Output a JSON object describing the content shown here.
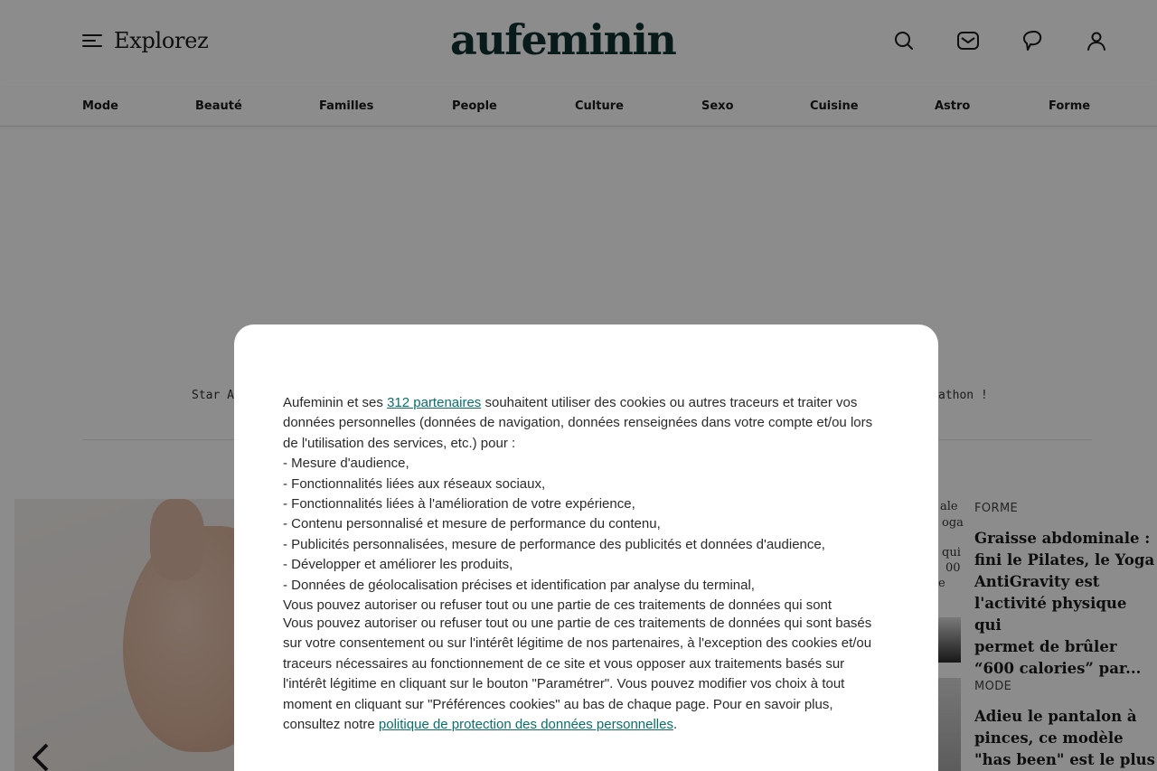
{
  "header": {
    "explore_label": "Explorez",
    "logo": "aufeminin",
    "icons": [
      "search-icon",
      "mail-icon",
      "chat-icon",
      "user-icon"
    ]
  },
  "nav": {
    "items": [
      "Mode",
      "Beauté",
      "Familles",
      "People",
      "Culture",
      "Sexo",
      "Cuisine",
      "Astro",
      "Forme"
    ]
  },
  "teaser": {
    "left_fragment": "Star Ac",
    "right_fragment": "athon !"
  },
  "side_fragments": [
    "ale",
    "oga",
    "qui",
    "00",
    "e"
  ],
  "articles": [
    {
      "category": "FORME",
      "title": "Graisse abdominale :\nfini le Pilates, le Yoga\nAntiGravity est\nl'activité physique qui\npermet de brûler\n“600 calories” par..."
    },
    {
      "category": "MODE",
      "title": "Adieu le pantalon à\npinces, ce modèle\n\"has been\" est le plus"
    }
  ],
  "consent": {
    "intro_before_link": "Aufeminin et ses ",
    "partners_link": "312 partenaires",
    "intro_after_link": " souhaitent utiliser des cookies ou autres traceurs et traiter vos données personnelles (données de navigation, données renseignées dans votre compte et/ou lors de l'utilisation des services, etc.) pour :",
    "purposes": [
      "- Mesure d'audience,",
      "- Fonctionnalités liées aux réseaux sociaux,",
      "- Fonctionnalités liées à l'amélioration de votre expérience,",
      "- Contenu personnalisé et mesure de performance du contenu,",
      "- Publicités personnalisées, mesure de performance des publicités et données d'audience,",
      "- Développer et améliorer les produits,",
      "- Données de géolocalisation précises et identification par analyse du terminal,"
    ],
    "overlap_line": "Vous pouvez autoriser ou refuser tout ou une partie de ces traitements de données qui sont",
    "body_text": "Vous pouvez autoriser ou refuser tout ou une partie de ces traitements de données qui sont basés sur votre consentement ou sur l'intérêt légitime de nos partenaires, à l'exception des cookies et/ou traceurs nécessaires au fonctionnement de ce site et vous opposer aux traitements basés sur l'intérêt légitime en cliquant sur le bouton \"Paramétrer\". Vous pouvez modifier vos choix à tout moment en cliquant sur \"Préférences cookies\" au bas de chaque page. Pour en savoir plus, consultez notre ",
    "privacy_link": "politique de protection des données personnelles",
    "body_end": "."
  },
  "colors": {
    "overlay": "#000000",
    "link": "#0a6f6b",
    "logo": "#0f3030"
  }
}
